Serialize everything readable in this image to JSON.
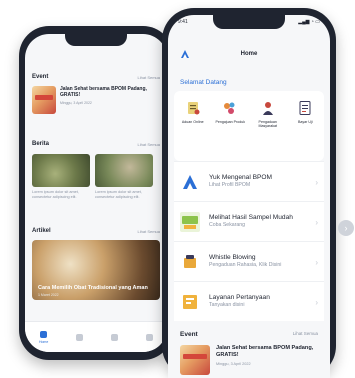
{
  "back_screen": {
    "event": {
      "title": "Event",
      "link": "Lihat Semua",
      "card_title": "Jalan Sehat bersama BPOM Padang, GRATIS!",
      "card_date": "Minggu, 3 April 2022"
    },
    "news": {
      "title": "Berita",
      "link": "Lihat Semua",
      "items": [
        {
          "caption": "Lorem ipsum dolor sit amet, consectetur adipiscing elit."
        },
        {
          "caption": "Lorem ipsum dolor sit amet, consectetur adipiscing elit."
        }
      ]
    },
    "articles": {
      "title": "Artikel",
      "link": "Lihat Semua",
      "card_title": "Cara Memilih Obat Tradisional yang Aman",
      "card_date": "1 Maret 2022"
    },
    "nav": {
      "home_label": "Home"
    }
  },
  "front_screen": {
    "status": {
      "time": "9:41",
      "icons": "▂▄▆ ◔ ▭"
    },
    "header": {
      "title": "Home"
    },
    "greeting": "Selamat Datang",
    "menu": [
      {
        "label": "Aduan Online",
        "icon": "complaint-icon"
      },
      {
        "label": "Pengajuan Produk",
        "icon": "products-icon"
      },
      {
        "label": "Pengaduan Masyarakat",
        "icon": "people-icon"
      },
      {
        "label": "Bayar Uji",
        "icon": "document-icon"
      }
    ],
    "list": [
      {
        "title": "Yuk Mengenal BPOM",
        "subtitle": "Lihat Profil BPOM",
        "icon": "bpom-logo-icon"
      },
      {
        "title": "Melihat Hasil Sampel Mudah",
        "subtitle": "Coba Sekarang",
        "icon": "sample-results-icon"
      },
      {
        "title": "Whistle Blowing",
        "subtitle": "Pengaduan Rahasia, Klik Disini",
        "icon": "whistle-blowing-icon"
      },
      {
        "title": "Layanan Pertanyaan",
        "subtitle": "Tanyakan disini",
        "icon": "question-service-icon"
      }
    ],
    "event": {
      "title": "Event",
      "link": "Lihat Semua",
      "card_title": "Jalan Sehat bersama BPOM Padang, GRATIS!",
      "card_date": "Minggu, 3 April 2022"
    }
  },
  "colors": {
    "accent": "#2b6fd6",
    "text": "#1f2430",
    "muted": "#8a93a3",
    "frame": "#1f2430"
  }
}
